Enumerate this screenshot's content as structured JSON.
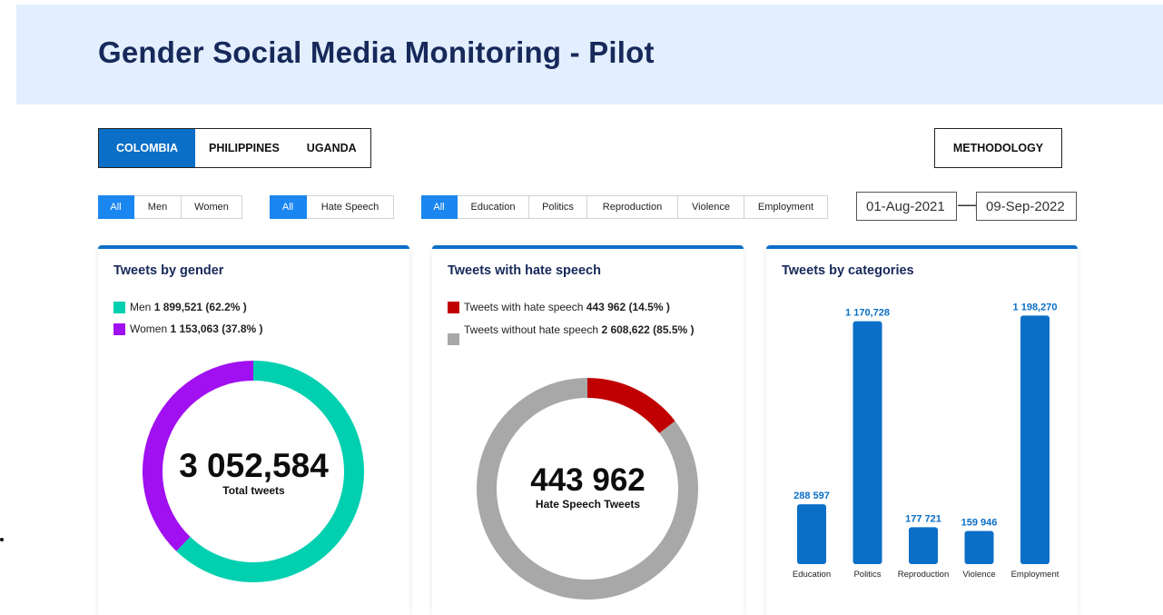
{
  "header": {
    "title": "Gender Social Media Monitoring - Pilot"
  },
  "country_tabs": [
    {
      "label": "COLOMBIA",
      "active": true
    },
    {
      "label": "PHILIPPINES",
      "active": false
    },
    {
      "label": "UGANDA",
      "active": false
    }
  ],
  "methodology_label": "METHODOLOGY",
  "filters": {
    "gender": [
      "All",
      "Men",
      "Women"
    ],
    "speech": [
      "All",
      "Hate Speech"
    ],
    "category": [
      "All",
      "Education",
      "Politics",
      "Reproduction",
      "Violence",
      "Employment"
    ]
  },
  "date_range": {
    "start": "01-Aug-2021",
    "end": "09-Sep-2022",
    "arrow": "⟶"
  },
  "cards": {
    "gender": {
      "title": "Tweets by gender",
      "legend": [
        {
          "label": "Men",
          "value": "1 899,521 (62.2% )",
          "color": "#00d0b0"
        },
        {
          "label": "Women",
          "value": "1 153,063 (37.8% )",
          "color": "#a010f0"
        }
      ],
      "total": "3 052,584",
      "total_label": "Total tweets"
    },
    "hate": {
      "title": "Tweets with hate speech",
      "legend": [
        {
          "label": "Tweets with hate speech",
          "value": "443 962 (14.5% )",
          "color": "#c00000"
        },
        {
          "label": "Tweets without hate speech",
          "value": "2 608,622 (85.5% )",
          "color": "#a8a8a8"
        }
      ],
      "total": "443 962",
      "total_label": "Hate Speech Tweets"
    },
    "categories": {
      "title": "Tweets by categories"
    }
  },
  "chart_data": [
    {
      "type": "pie",
      "title": "Tweets by gender",
      "categories": [
        "Men",
        "Women"
      ],
      "values": [
        1899521,
        1153063
      ],
      "percent": [
        62.2,
        37.8
      ],
      "colors": [
        "#00d0b0",
        "#a010f0"
      ]
    },
    {
      "type": "pie",
      "title": "Tweets with hate speech",
      "categories": [
        "Tweets with hate speech",
        "Tweets without hate speech"
      ],
      "values": [
        443962,
        2608622
      ],
      "percent": [
        14.5,
        85.5
      ],
      "colors": [
        "#c00000",
        "#a8a8a8"
      ]
    },
    {
      "type": "bar",
      "title": "Tweets by categories",
      "categories": [
        "Education",
        "Politics",
        "Reproduction",
        "Violence",
        "Employment"
      ],
      "values": [
        288597,
        1170728,
        177721,
        159946,
        1198270
      ],
      "value_labels": [
        "288 597",
        "1 170,728",
        "177 721",
        "159 946",
        "1 198,270"
      ],
      "color": "#0b6fc7"
    }
  ]
}
